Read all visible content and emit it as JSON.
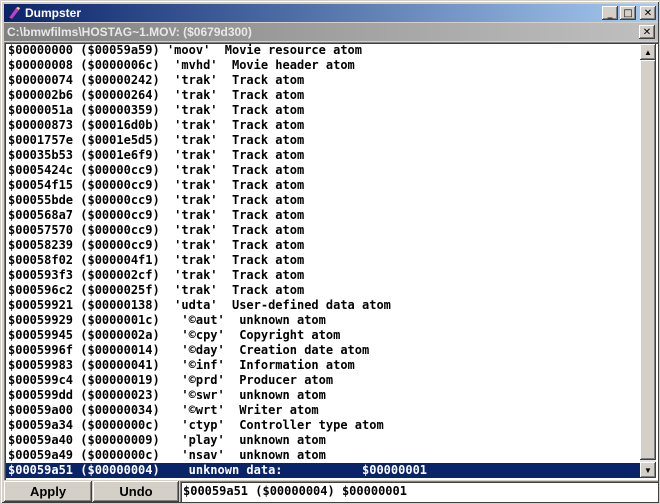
{
  "window": {
    "title": "Dumpster",
    "path": "C:\\bmwfilms\\HOSTAG~1.MOV: ($0679d300)",
    "minimize_glyph": "_",
    "maximize_glyph": "□",
    "close_glyph": "✕"
  },
  "rows": [
    "$00000000 ($00059a59) 'moov'  Movie resource atom",
    "$00000008 ($0000006c)  'mvhd'  Movie header atom",
    "$00000074 ($00000242)  'trak'  Track atom",
    "$000002b6 ($00000264)  'trak'  Track atom",
    "$0000051a ($00000359)  'trak'  Track atom",
    "$00000873 ($00016d0b)  'trak'  Track atom",
    "$0001757e ($0001e5d5)  'trak'  Track atom",
    "$00035b53 ($0001e6f9)  'trak'  Track atom",
    "$0005424c ($00000cc9)  'trak'  Track atom",
    "$00054f15 ($00000cc9)  'trak'  Track atom",
    "$00055bde ($00000cc9)  'trak'  Track atom",
    "$000568a7 ($00000cc9)  'trak'  Track atom",
    "$00057570 ($00000cc9)  'trak'  Track atom",
    "$00058239 ($00000cc9)  'trak'  Track atom",
    "$00058f02 ($000004f1)  'trak'  Track atom",
    "$000593f3 ($000002cf)  'trak'  Track atom",
    "$000596c2 ($0000025f)  'trak'  Track atom",
    "$00059921 ($00000138)  'udta'  User-defined data atom",
    "$00059929 ($0000001c)   '©aut'  unknown atom",
    "$00059945 ($0000002a)   '©cpy'  Copyright atom",
    "$0005996f ($00000014)   '©day'  Creation date atom",
    "$00059983 ($00000041)   '©inf'  Information atom",
    "$000599c4 ($00000019)   '©prd'  Producer atom",
    "$000599dd ($00000023)   '©swr'  unknown atom",
    "$00059a00 ($00000034)   '©wrt'  Writer atom",
    "$00059a34 ($0000000c)   'ctyp'  Controller type atom",
    "$00059a40 ($00000009)   'play'  unknown atom",
    "$00059a49 ($0000000c)   'nsav'  unknown atom"
  ],
  "selected_row": "$00059a51 ($00000004)    unknown data:           $00000001",
  "toolbar": {
    "apply_label": "Apply",
    "undo_label": "Undo",
    "edit_value": "$00059a51 ($00000004) $00000001"
  }
}
